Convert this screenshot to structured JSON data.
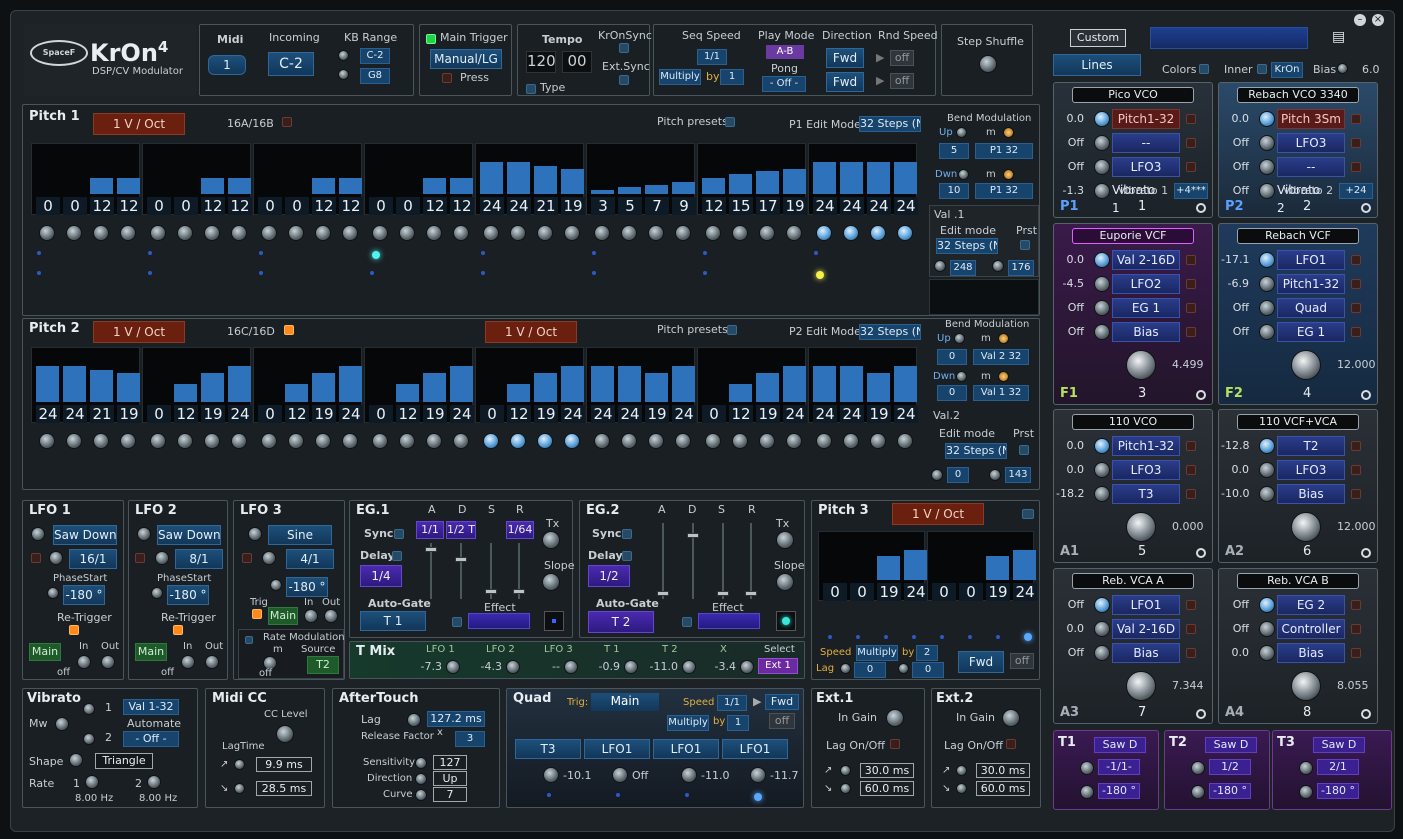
{
  "header": {
    "brand": "SpaceF",
    "logo_title": "KrOn",
    "logo_version": "4",
    "subtitle": "DSP/CV Modulator",
    "midi": {
      "label": "Midi",
      "value": "1"
    },
    "incoming": {
      "label": "Incoming",
      "value": "C-2"
    },
    "kb_range": {
      "label": "KB Range",
      "low": "C-2",
      "high": "G8"
    },
    "main_trigger": {
      "label": "Main Trigger",
      "value": "Manual/LG",
      "press": "Press"
    },
    "tempo": {
      "label": "Tempo",
      "value1": "120",
      "value2": "00",
      "type": "Type",
      "kronsync": "KrOnSync",
      "extsync": "Ext.Sync"
    },
    "seq_speed": {
      "label": "Seq Speed",
      "value": "1/1",
      "multiply": "Multiply",
      "by": "by",
      "by_value": "1"
    },
    "play_mode": {
      "label": "Play Mode",
      "value": "A-B",
      "pong_label": "Pong",
      "pong_value": "- Off -"
    },
    "direction": {
      "label": "Direction",
      "value1": "Fwd",
      "value2": "Fwd"
    },
    "rnd_speed": {
      "label": "Rnd Speed",
      "value1": "off",
      "value2": "off"
    },
    "step_shuffle": {
      "label": "Step Shuffle"
    },
    "custom": "Custom",
    "lines": "Lines",
    "colors": "Colors",
    "inner": "Inner",
    "inner_value": "KrOn",
    "bias": "Bias",
    "bias_value": "6.0",
    "colors_hex": {
      "accent": "#2d72bb",
      "panel": "#1a1f23",
      "red": "#6a1f0f"
    }
  },
  "pitch1": {
    "title": "Pitch 1",
    "mode": "1 V / Oct",
    "notes": "16A/16B",
    "presets": "Pitch presets",
    "edit_mode_label": "P1 Edit Mode",
    "edit_mode": "32 Steps (N",
    "steps": [
      0,
      0,
      12,
      12,
      0,
      0,
      12,
      12,
      0,
      0,
      12,
      12,
      0,
      0,
      12,
      12,
      24,
      24,
      21,
      19,
      3,
      5,
      7,
      9,
      12,
      15,
      17,
      19,
      24,
      24,
      24,
      24
    ],
    "bend_label": "Bend Modulation",
    "up": "Up",
    "dwn": "Dwn",
    "m": "m",
    "up_val": "5",
    "up_src": "P1 32",
    "dwn_val": "10",
    "dwn_src": "P1 32",
    "val_label": "Val .1",
    "edit_label": "Edit mode",
    "prst": "Prst",
    "val_mode": "32 Steps (N",
    "v1": "248",
    "v2": "176"
  },
  "pitch2": {
    "title": "Pitch 2",
    "mode": "1 V / Oct",
    "notes": "16C/16D",
    "mode2": "1 V / Oct",
    "presets": "Pitch presets",
    "edit_mode_label": "P2 Edit Mode",
    "edit_mode": "32 Steps (N",
    "steps": [
      24,
      24,
      21,
      19,
      0,
      12,
      19,
      24,
      0,
      12,
      19,
      24,
      0,
      12,
      19,
      24,
      0,
      12,
      19,
      24,
      24,
      24,
      19,
      24,
      0,
      12,
      19,
      24,
      24,
      24,
      19,
      24
    ],
    "bend_label": "Bend Modulation",
    "up": "Up",
    "dwn": "Dwn",
    "m": "m",
    "up_val": "0",
    "up_src": "Val 2 32",
    "dwn_val": "0",
    "dwn_src": "Val 1 32",
    "val_label": "Val.2",
    "edit_label": "Edit mode",
    "prst": "Prst",
    "val_mode": "32 Steps (N",
    "v1": "0",
    "v2": "143"
  },
  "lfo1": {
    "title": "LFO 1",
    "wave": "Saw Down",
    "rate": "16/1",
    "phase_label": "PhaseStart",
    "phase": "-180 °",
    "retrig": "Re-Trigger",
    "src": "Main",
    "in": "In",
    "out": "Out",
    "off": "off"
  },
  "lfo2": {
    "title": "LFO 2",
    "wave": "Saw Down",
    "rate": "8/1",
    "phase_label": "PhaseStart",
    "phase": "-180 °",
    "retrig": "Re-Trigger",
    "src": "Main",
    "in": "In",
    "out": "Out",
    "off": "off"
  },
  "lfo3": {
    "title": "LFO 3",
    "wave": "Sine",
    "rate": "4/1",
    "phase": "-180 °",
    "trig": "Trig",
    "src": "Main",
    "in": "In",
    "out": "Out",
    "rate_mod": "Rate Modulation",
    "m": "m",
    "source": "Source",
    "src_value": "T2",
    "off": "off"
  },
  "eg1": {
    "title": "EG.1",
    "a": "A",
    "d": "D",
    "s": "S",
    "r": "R",
    "sync": "Sync",
    "delay": "Delay",
    "a_val": "1/1",
    "d_val": "1/2 T",
    "r_val": "1/64",
    "delay_val": "1/4",
    "tx": "Tx",
    "slope": "Slope",
    "autogate": "Auto-Gate",
    "gate_src": "T 1",
    "effect": "Effect"
  },
  "eg2": {
    "title": "EG.2",
    "a": "A",
    "d": "D",
    "s": "S",
    "r": "R",
    "sync": "Sync",
    "delay": "Delay",
    "delay_val": "1/2",
    "tx": "Tx",
    "slope": "Slope",
    "autogate": "Auto-Gate",
    "gate_src": "T 2",
    "effect": "Effect"
  },
  "tmix": {
    "title": "T Mix",
    "labels": [
      "LFO 1",
      "LFO 2",
      "LFO 3",
      "T 1",
      "T 2",
      "X"
    ],
    "values": [
      "-7.3",
      "-4.3",
      "--",
      "-0.9",
      "-11.0",
      "-3.4"
    ],
    "select": "Select",
    "select_val": "Ext 1"
  },
  "pitch3": {
    "title": "Pitch 3",
    "mode": "1 V / Oct",
    "steps": [
      0,
      0,
      19,
      24,
      0,
      0,
      19,
      24
    ],
    "speed": "Speed",
    "multiply": "Multiply",
    "by": "by",
    "by_val": "2",
    "lag": "Lag",
    "lag1": "0",
    "lag2": "0",
    "dir": "Fwd",
    "off": "off"
  },
  "vibrato": {
    "title": "Vibrato",
    "mw": "Mw",
    "one": "1",
    "two": "2",
    "src": "Val 1-32",
    "automate": "Automate",
    "auto_val": "- Off -",
    "shape": "Shape",
    "shape_val": "Triangle",
    "rate": "Rate",
    "r1": "1",
    "r2": "2",
    "hz1": "8.00 Hz",
    "hz2": "8.00 Hz"
  },
  "midicc": {
    "title": "Midi CC",
    "cc_level": "CC Level",
    "lagtime": "LagTime",
    "t1": "9.9 ms",
    "t2": "28.5 ms"
  },
  "aftertouch": {
    "title": "AfterTouch",
    "lag": "Lag",
    "lag_val": "127.2 ms",
    "rf": "Release Factor",
    "x": "x",
    "rf_val": "3",
    "sens": "Sensitivity",
    "sens_val": "127",
    "dir": "Direction",
    "dir_val": "Up",
    "curve": "Curve",
    "curve_val": "7"
  },
  "quad": {
    "title": "Quad",
    "trig": "Trig:",
    "trig_val": "Main",
    "speed": "Speed",
    "speed_val": "1/1",
    "fwd": "Fwd",
    "multiply": "Multiply",
    "by": "by",
    "by_val": "1",
    "off": "off",
    "slots": [
      "T3",
      "LFO1",
      "LFO1",
      "LFO1"
    ],
    "values": [
      "-10.1",
      "Off",
      "-11.0",
      "-11.7"
    ]
  },
  "ext1": {
    "title": "Ext.1",
    "gain": "In Gain",
    "lag": "Lag On/Off",
    "t1": "30.0 ms",
    "t2": "60.0 ms"
  },
  "ext2": {
    "title": "Ext.2",
    "gain": "In Gain",
    "lag": "Lag On/Off",
    "t1": "30.0 ms",
    "t2": "60.0 ms"
  },
  "modules": [
    {
      "header": "Pico VCO",
      "vals": [
        "0.0",
        "Off",
        "Off",
        "-1.3"
      ],
      "slots": [
        "Pitch1-32",
        "--",
        "LFO3",
        "Vibrato 1"
      ],
      "extra": "+4***",
      "id": "P1",
      "num": "1"
    },
    {
      "header": "Rebach VCO 3340",
      "vals": [
        "0.0",
        "Off",
        "Off",
        "Off"
      ],
      "slots": [
        "Pitch 3Sm",
        "LFO3",
        "--",
        "Vibrato 2"
      ],
      "extra": "+24",
      "id": "P2",
      "num": "2"
    },
    {
      "header": "Euporie VCF",
      "vals": [
        "0.0",
        "-4.5",
        "Off",
        "Off"
      ],
      "slots": [
        "Val 2-16D",
        "LFO2",
        "EG 1",
        "Bias"
      ],
      "knob": "4.499",
      "id": "F1",
      "num": "3"
    },
    {
      "header": "Rebach VCF",
      "vals": [
        "-17.1",
        "-6.9",
        "Off",
        "Off"
      ],
      "slots": [
        "LFO1",
        "Pitch1-32",
        "Quad",
        "EG 1"
      ],
      "knob": "12.000",
      "id": "F2",
      "num": "4"
    },
    {
      "header": "110 VCO",
      "vals": [
        "0.0",
        "0.0",
        "-18.2"
      ],
      "slots": [
        "Pitch1-32",
        "LFO3",
        "T3"
      ],
      "knob": "0.000",
      "id": "A1",
      "num": "5"
    },
    {
      "header": "110 VCF+VCA",
      "vals": [
        "-12.8",
        "0.0",
        "-10.0"
      ],
      "slots": [
        "T2",
        "LFO3",
        "Bias"
      ],
      "knob": "12.000",
      "id": "A2",
      "num": "6"
    },
    {
      "header": "Reb. VCA A",
      "vals": [
        "Off",
        "0.0",
        "Off"
      ],
      "slots": [
        "LFO1",
        "Val 2-16D",
        "Bias"
      ],
      "knob": "7.344",
      "id": "A3",
      "num": "7"
    },
    {
      "header": "Reb. VCA B",
      "vals": [
        "Off",
        "Off",
        "0.0"
      ],
      "slots": [
        "EG 2",
        "Controller",
        "Bias"
      ],
      "knob": "8.055",
      "id": "A4",
      "num": "8"
    }
  ],
  "tgens": [
    {
      "title": "T1",
      "wave": "Saw D",
      "rate": "-1/1-",
      "phase": "-180 °"
    },
    {
      "title": "T2",
      "wave": "Saw D",
      "rate": "1/2",
      "phase": "-180 °"
    },
    {
      "title": "T3",
      "wave": "Saw D",
      "rate": "2/1",
      "phase": "-180 °"
    }
  ]
}
